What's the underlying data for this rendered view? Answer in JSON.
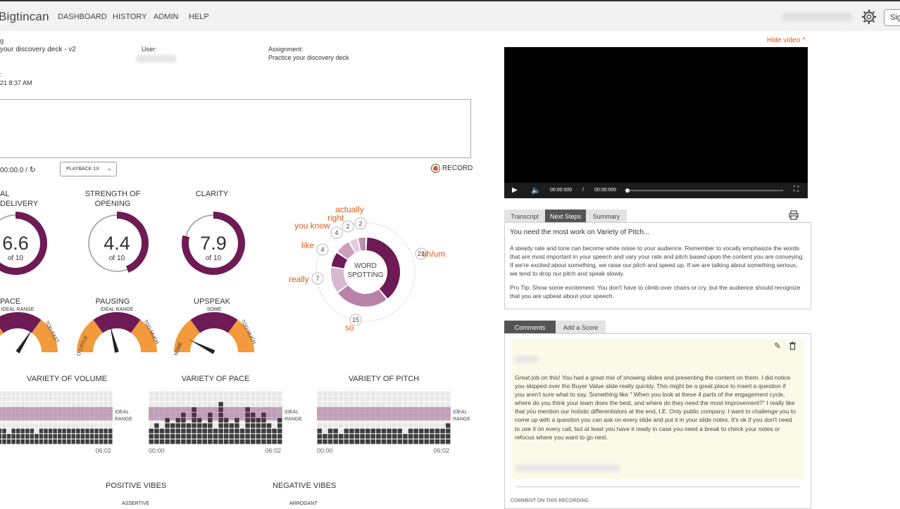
{
  "nav": {
    "logo": "Bigtincan",
    "items": [
      "DASHBOARD",
      "HISTORY",
      "ADMIN",
      "HELP"
    ],
    "sign_button": "Sig"
  },
  "meta": {
    "label_top": "g",
    "title_value": "your discovery deck - v2",
    "user_label": "User:",
    "assignment_label": "Assignment:",
    "assignment_value": "Practice your discovery deck",
    "date_label": ":",
    "date_value": "21 8:37 AM"
  },
  "controls": {
    "timer": "00:00.0 /",
    "playback": "PLAYBACK 1X",
    "record": "RECORD"
  },
  "gauges": [
    {
      "label": "AL DELIVERY",
      "value": "6.6",
      "of": "of 10",
      "fraction": 0.66
    },
    {
      "label": "STRENGTH OF OPENING",
      "value": "4.4",
      "of": "of 10",
      "fraction": 0.44
    },
    {
      "label": "CLARITY",
      "value": "7.9",
      "of": "of 10",
      "fraction": 0.79
    }
  ],
  "meters": [
    {
      "label": "PACE",
      "left": "",
      "top": "IDEAL RANGE",
      "right": "TOO FAST",
      "needle": 0.68
    },
    {
      "label": "PAUSING",
      "left": "TOO LITTLE",
      "top": "IDEAL RANGE",
      "right": "TOO MUCH",
      "needle": 0.42
    },
    {
      "label": "UPSPEAK",
      "left": "NONE",
      "top": "SOME",
      "right": "TOO MUCH",
      "needle": 0.15
    }
  ],
  "word_spotting": {
    "title_1": "WORD",
    "title_2": "SPOTTING",
    "words": [
      {
        "word": "uh/um",
        "count": 23
      },
      {
        "word": "so",
        "count": 15
      },
      {
        "word": "really",
        "count": 7
      },
      {
        "word": "like",
        "count": 4
      },
      {
        "word": "you know",
        "count": 4
      },
      {
        "word": "right",
        "count": 2
      },
      {
        "word": "actually",
        "count": 2
      }
    ]
  },
  "variety": [
    {
      "title": "VARIETY OF VOLUME",
      "start": "",
      "end": "06:02",
      "ideal": "IDEAL RANGE"
    },
    {
      "title": "VARIETY OF PACE",
      "start": "00:00",
      "end": "06:02",
      "ideal": "IDEAL RANGE"
    },
    {
      "title": "VARIETY OF PITCH",
      "start": "00:00",
      "end": "06:02",
      "ideal": "IDEAL RANGE"
    }
  ],
  "vibes": {
    "positive": "POSITIVE VIBES",
    "positive_sub": "ASSERTIVE",
    "negative": "NEGATIVE VIBES",
    "negative_sub": "ARROGANT"
  },
  "video": {
    "hide_label": "Hide video ^",
    "current": "00:00:000",
    "sep": "/",
    "duration": "00:00:000"
  },
  "tabs": {
    "transcript": "Transcript",
    "next_steps": "Next Steps",
    "summary": "Summary",
    "comments": "Comments",
    "add_score": "Add a Score"
  },
  "next_steps": {
    "heading": "You need the most work on Variety of Pitch...",
    "body": "A steady rate and tone can become white noise to your audience. Remember to vocally emphasize the words that are most important in your speech and vary your rate and pitch based upon the content you are conveying. If we're excited about something, we raise our pitch and speed up. If we are talking about something serious, we tend to drop our pitch and speak slowly.",
    "tip": "Pro Tip: Show some excitement. You don't have to climb over chairs or cry, but the audience should recognize that you are upbeat about your speech."
  },
  "comment": {
    "text": "Great job on this! You had a great mix of showing slides and presenting the content on them. I did notice you skipped over the Buyer Value slide really quickly. This might be a great place to insert a question if you aren't sure what to say. Something like \" When you look at these 4 parts of the engagement cycle, where do you think your team does the best, and where do they need the most improvement?\" I really like that you mention our holistic differentiators at the end, I.E. Only public company. I want to challenge you to come up with a question you can ask on every slide and put it in your slide notes. It's ok if you don't need to use it on every call, but at least you have it ready in case you need a break to check your notes or refocus where you want to go next.",
    "footer": "COMMENT ON THIS RECORDING"
  },
  "colors": {
    "accent": "#e05a1e",
    "purple": "#6e1a55",
    "orange": "#f29a3c",
    "lilac": "#b982a8"
  }
}
